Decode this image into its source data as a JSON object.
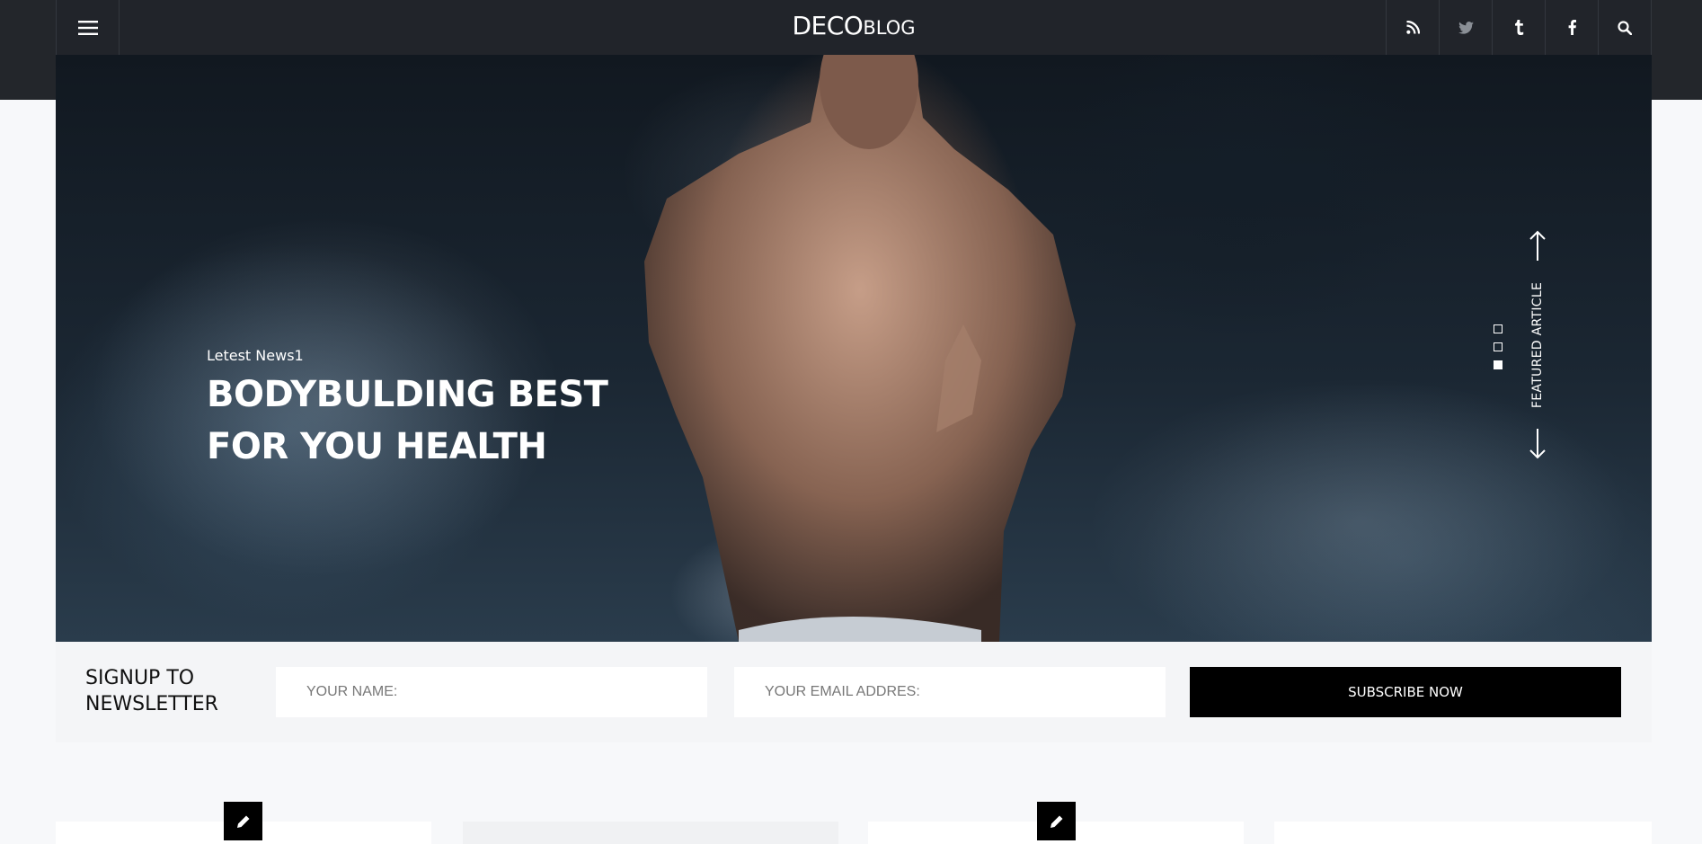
{
  "header": {
    "logo_main": "DECO",
    "logo_sub": "BLOG",
    "menu_icon": "hamburger-menu-icon",
    "social": [
      {
        "name": "rss-icon"
      },
      {
        "name": "twitter-icon"
      },
      {
        "name": "tumblr-icon"
      },
      {
        "name": "facebook-icon"
      },
      {
        "name": "search-icon"
      }
    ]
  },
  "hero": {
    "kicker": "Letest News1",
    "headline": "BODYBULDING BEST FOR YOU HEALTH",
    "featured_label": "FEATURED ARTICLE",
    "slides": 3,
    "active_slide": 3
  },
  "newsletter": {
    "title_line1": "SIGNUP TO",
    "title_line2": "NEWSLETTER",
    "name_placeholder": "YOUR NAME:",
    "email_placeholder": "YOUR EMAIL ADDRES:",
    "submit_label": "SUBSCRIBE NOW"
  },
  "colors": {
    "header_bg": "#21242a",
    "page_bg": "#f7f8fa",
    "button_bg": "#000000"
  }
}
